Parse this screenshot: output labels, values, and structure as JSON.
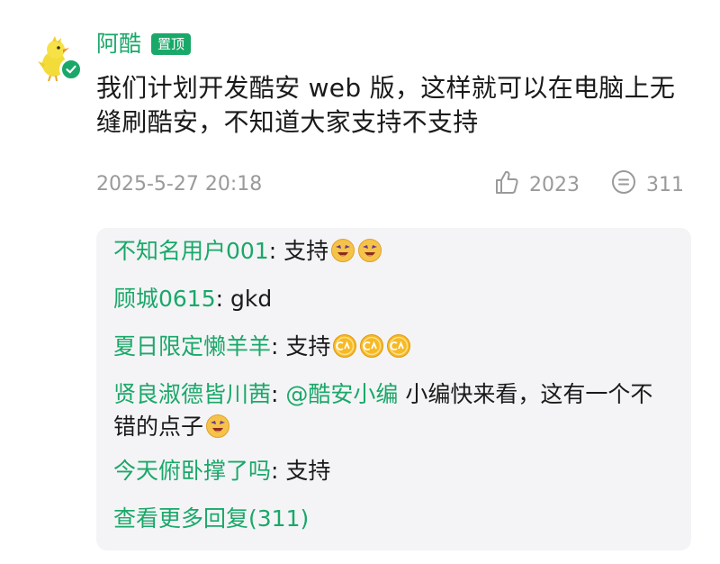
{
  "post": {
    "author": "阿酷",
    "pin_badge": "置顶",
    "content": "我们计划开发酷安 web 版，这样就可以在电脑上无缝刷酷安，不知道大家支持不支持",
    "timestamp": "2025-5-27 20:18",
    "like_count": "2023",
    "comment_count": "311",
    "avatar_icon": "chick-avatar-icon",
    "verified_icon": "verified-check-icon"
  },
  "colors": {
    "accent": "#1aa869",
    "muted_text": "#9a9a9a",
    "reply_bg": "#f4f4f6"
  },
  "replies": [
    {
      "author": "不知名用户001",
      "separator": ": ",
      "text": "支持",
      "emojis": [
        "laughing-emoji",
        "laughing-emoji"
      ]
    },
    {
      "author": "顾城0615",
      "separator": ": ",
      "text": "gkd",
      "emojis": []
    },
    {
      "author": "夏日限定懒羊羊",
      "separator": ": ",
      "text": "支持",
      "emojis": [
        "coolapk-coin-emoji",
        "coolapk-coin-emoji",
        "coolapk-coin-emoji"
      ]
    },
    {
      "author": "贤良淑德皆川茜",
      "separator": ": ",
      "mention": "@酷安小编",
      "text": " 小编快来看，这有一个不错的点子",
      "emojis": [
        "laughing-emoji"
      ]
    },
    {
      "author": "今天俯卧撑了吗",
      "separator": ": ",
      "text": "支持",
      "emojis": []
    }
  ],
  "view_more": "查看更多回复(311)"
}
